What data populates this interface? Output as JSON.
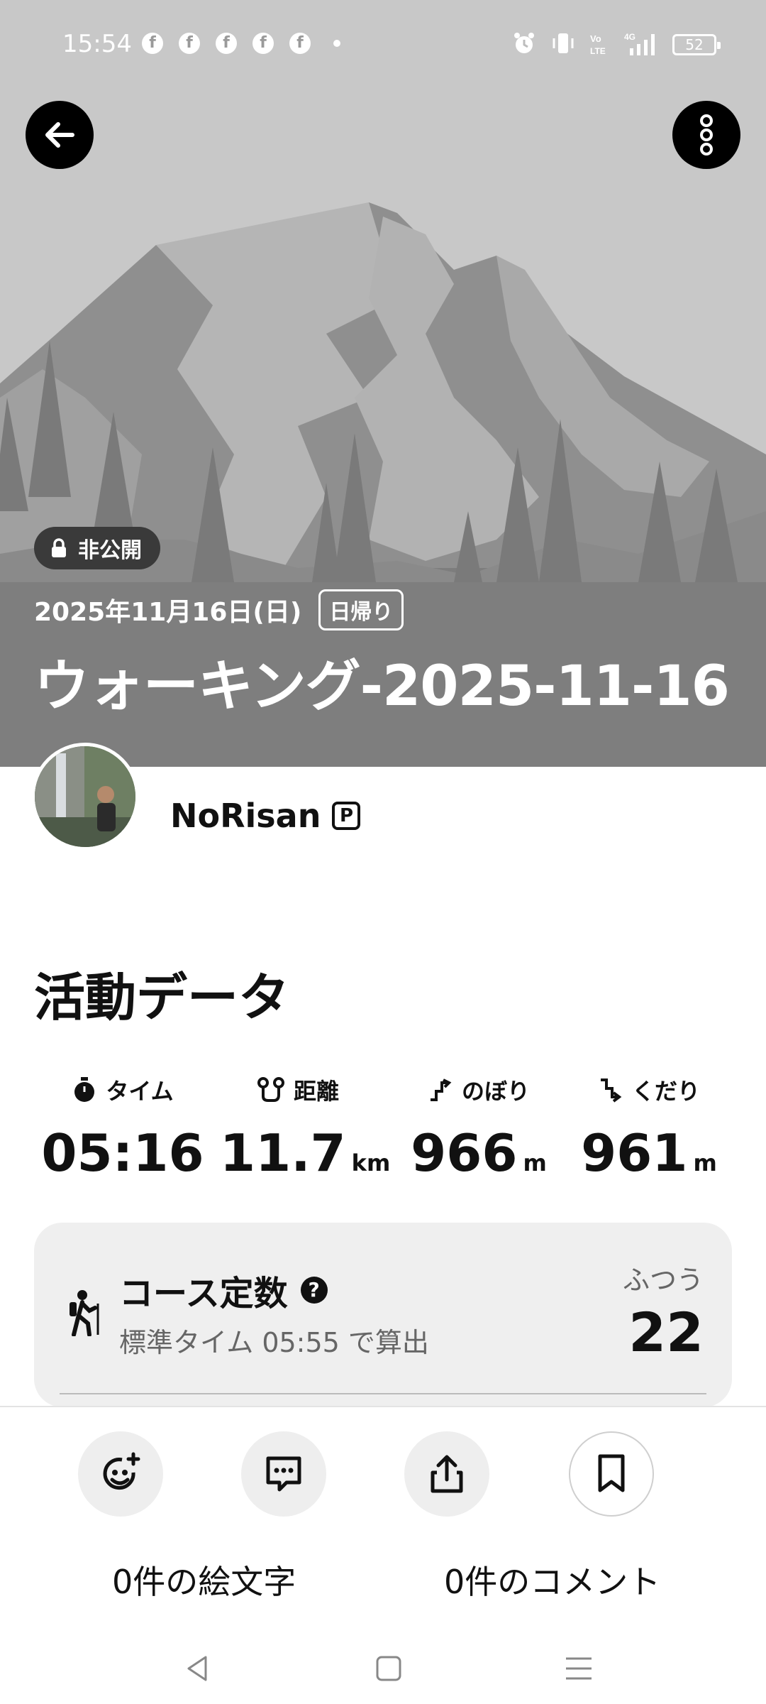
{
  "status_bar": {
    "time": "15:54",
    "notification_icon": "facebook-icon",
    "notification_letter": "f",
    "battery": "52"
  },
  "hero": {
    "privacy_label": "非公開",
    "date": "2025年11月16日(日)",
    "trip_type": "日帰り",
    "title": "ウォーキング-2025-11-16"
  },
  "user": {
    "name": "NoRisan",
    "badge": "P"
  },
  "activity": {
    "section_title": "活動データ",
    "stats": [
      {
        "label": "タイム",
        "value": "05:16",
        "unit": "",
        "icon": "stopwatch-icon"
      },
      {
        "label": "距離",
        "value": "11.7",
        "unit": "km",
        "icon": "route-icon"
      },
      {
        "label": "のぼり",
        "value": "966",
        "unit": "m",
        "icon": "ascent-icon"
      },
      {
        "label": "くだり",
        "value": "961",
        "unit": "m",
        "icon": "descent-icon"
      }
    ]
  },
  "course": {
    "title": "コース定数",
    "help": "?",
    "subtitle": "標準タイム 05:55 で算出",
    "level": "ふつう",
    "value": "22"
  },
  "actions": {
    "emoji_label": "0件の絵文字",
    "comment_label": "0件のコメント"
  },
  "colors": {
    "hero_bg": "#c9c9c9",
    "card_bg": "#efefef",
    "text": "#111111"
  }
}
